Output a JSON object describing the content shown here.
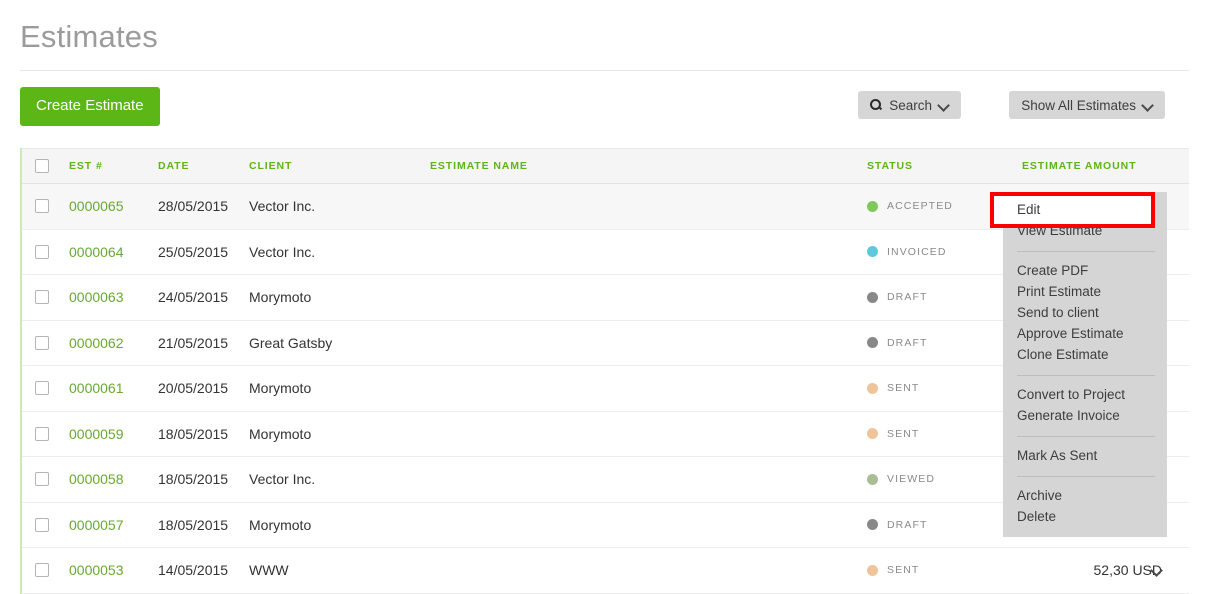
{
  "page": {
    "title": "Estimates"
  },
  "toolbar": {
    "create_label": "Create Estimate",
    "search_label": "Search",
    "search_icon": "search-icon",
    "search_caret_icon": "chevron-down-icon",
    "filter_label": "Show All Estimates",
    "filter_caret_icon": "chevron-down-icon"
  },
  "table": {
    "columns": {
      "est": "EST #",
      "date": "DATE",
      "client": "CLIENT",
      "estimate_name": "ESTIMATE NAME",
      "status": "STATUS",
      "amount": "ESTIMATE AMOUNT"
    },
    "rows": [
      {
        "est": "0000065",
        "date": "28/05/2015",
        "client": "Vector Inc.",
        "name": "",
        "status": "ACCEPTED",
        "status_color": "#7ec95a",
        "amount": "",
        "caret": "chevron-up-icon"
      },
      {
        "est": "0000064",
        "date": "25/05/2015",
        "client": "Vector Inc.",
        "name": "",
        "status": "INVOICED",
        "status_color": "#5ec8dd",
        "amount": "",
        "caret": "chevron-down-icon"
      },
      {
        "est": "0000063",
        "date": "24/05/2015",
        "client": "Morymoto",
        "name": "",
        "status": "DRAFT",
        "status_color": "#888888",
        "amount": "",
        "caret": "chevron-down-icon"
      },
      {
        "est": "0000062",
        "date": "21/05/2015",
        "client": "Great Gatsby",
        "name": "",
        "status": "DRAFT",
        "status_color": "#888888",
        "amount": "",
        "caret": "chevron-down-icon"
      },
      {
        "est": "0000061",
        "date": "20/05/2015",
        "client": "Morymoto",
        "name": "",
        "status": "SENT",
        "status_color": "#f0c49a",
        "amount": "",
        "caret": "chevron-down-icon"
      },
      {
        "est": "0000059",
        "date": "18/05/2015",
        "client": "Morymoto",
        "name": "",
        "status": "SENT",
        "status_color": "#f0c49a",
        "amount": "",
        "caret": "chevron-down-icon"
      },
      {
        "est": "0000058",
        "date": "18/05/2015",
        "client": "Vector Inc.",
        "name": "",
        "status": "VIEWED",
        "status_color": "#a8bf93",
        "amount": "",
        "caret": "chevron-down-icon"
      },
      {
        "est": "0000057",
        "date": "18/05/2015",
        "client": "Morymoto",
        "name": "",
        "status": "DRAFT",
        "status_color": "#888888",
        "amount": "",
        "caret": "chevron-down-icon"
      },
      {
        "est": "0000053",
        "date": "14/05/2015",
        "client": "WWW",
        "name": "",
        "status": "SENT",
        "status_color": "#f0c49a",
        "amount": "52,30 USD",
        "caret": "chevron-down-icon"
      }
    ]
  },
  "context_menu": {
    "groups": [
      [
        "Edit",
        "View Estimate"
      ],
      [
        "Create PDF",
        "Print Estimate",
        "Send to client",
        "Approve Estimate",
        "Clone Estimate"
      ],
      [
        "Convert to Project",
        "Generate Invoice"
      ],
      [
        "Mark As Sent"
      ],
      [
        "Archive",
        "Delete"
      ]
    ],
    "highlighted_item": "Edit"
  },
  "annotation": {
    "highlight_color": "#fb0000"
  }
}
